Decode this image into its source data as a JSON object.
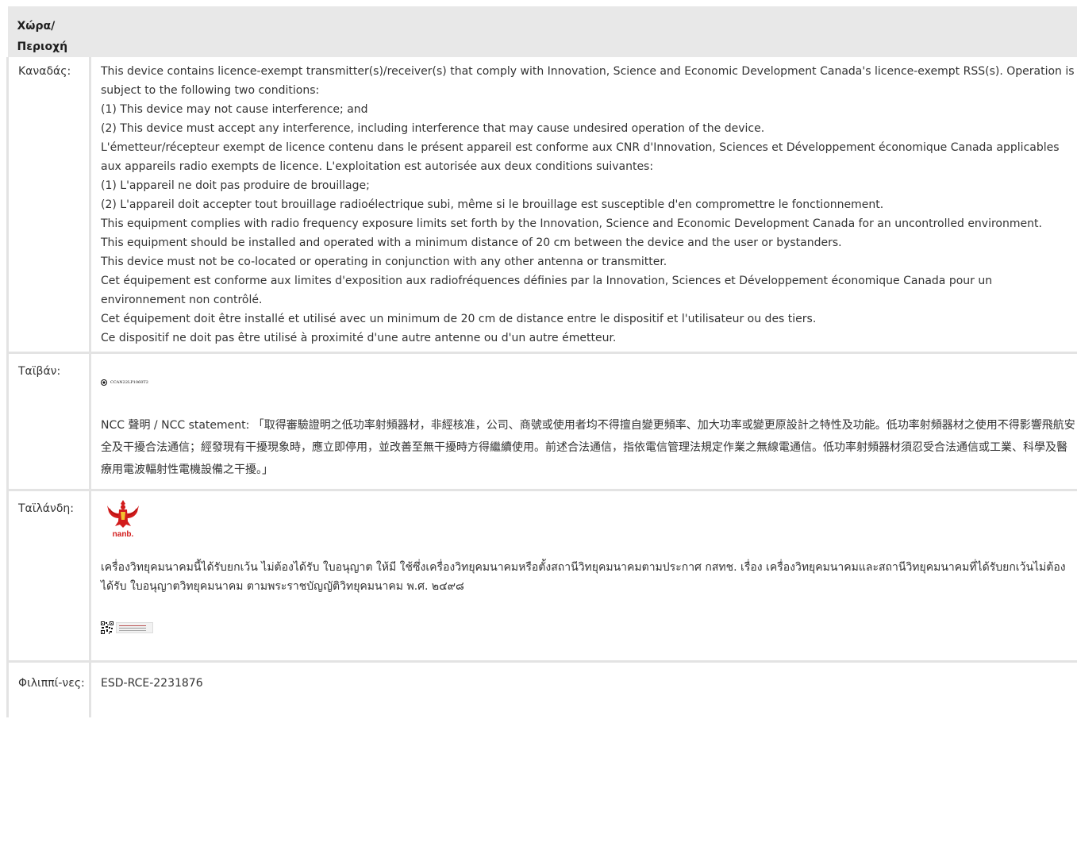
{
  "header": {
    "country_region": "Χώρα/ Περιοχή"
  },
  "rows": {
    "canada": {
      "country": "Καναδάς:",
      "lines": [
        "This device contains licence-exempt transmitter(s)/receiver(s) that comply with Innovation, Science and Economic Development Canada's licence-exempt RSS(s). Operation is subject to the following two conditions:",
        "(1) This device may not cause interference; and",
        "(2) This device must accept any interference, including interference that may cause undesired operation of the device.",
        "L'émetteur/récepteur exempt de licence contenu dans le présent appareil est conforme aux CNR d'Innovation, Sciences et Développement économique Canada applicables aux appareils radio exempts de licence. L'exploitation est autorisée aux deux conditions suivantes:",
        "(1) L'appareil ne doit pas produire de brouillage;",
        "(2) L'appareil doit accepter tout brouillage radioélectrique subi, même si le brouillage est susceptible d'en compromettre le fonctionnement.",
        "This equipment complies with radio frequency exposure limits set forth by the Innovation, Science and Economic Development Canada for an uncontrolled environment.",
        "This equipment should be installed and operated with a minimum distance of 20 cm between the device and the user or bystanders.",
        "This device must not be co-located or operating in conjunction with any other antenna or transmitter.",
        "Cet équipement est conforme aux limites d'exposition aux radiofréquences définies par la Innovation, Sciences et Développement économique Canada pour un environnement non contrôlé.",
        "Cet équipement doit être installé et utilisé avec un minimum de 20 cm de distance entre le dispositif et l'utilisateur ou des tiers.",
        "Ce dispositif ne doit pas être utilisé à proximité d'une autre antenne ou d'un autre émetteur."
      ]
    },
    "taiwan": {
      "country": "Ταϊβάν:",
      "ncc_code": "CCAN22LP1060T2",
      "statement": "NCC 聲明 / NCC statement: 「取得審驗證明之低功率射頻器材，非經核准，公司、商號或使用者均不得擅自變更頻率、加大功率或變更原設計之特性及功能。低功率射頻器材之使用不得影響飛航安全及干擾合法通信；經發現有干擾現象時，應立即停用，並改善至無干擾時方得繼續使用。前述合法通信，指依電信管理法規定作業之無線電通信。低功率射頻器材須忍受合法通信或工業、科學及醫療用電波輻射性電機設備之干擾。」"
    },
    "thailand": {
      "country": "Ταϊλάνδη:",
      "logo_text": "nanb.",
      "statement": "เครื่องวิทยุคมนาคมนี้ได้รับยกเว้น ไม่ต้องได้รับ ใบอนุญาต ให้มี ใช้ซึ่งเครื่องวิทยุคมนาคมหรือตั้งสถานีวิทยุคมนาคมตามประกาศ กสทช. เรื่อง เครื่องวิทยุคมนาคมและสถานีวิทยุคมนาคมที่ได้รับยกเว้นไม่ต้องได้รับ ใบอนุญาตวิทยุคมนาคม ตามพระราชบัญญัติวิทยุคมนาคม พ.ศ. ๒๔๙๘",
      "label_icon": "qr-code-icon"
    },
    "philippines": {
      "country": "Φιλιππί-νες:",
      "value": "ESD-RCE-2231876"
    }
  },
  "colors": {
    "header_bg": "#e8e8e8",
    "border": "#e3e3e3",
    "text": "#333333",
    "garuda_red": "#d21c1c"
  }
}
